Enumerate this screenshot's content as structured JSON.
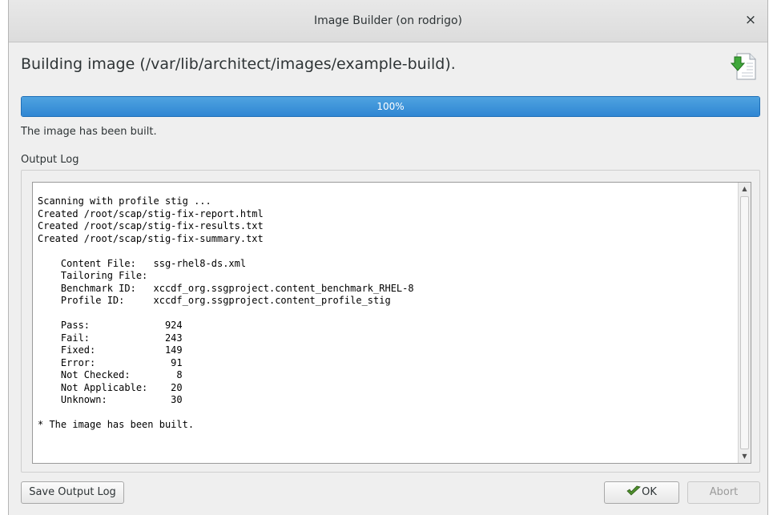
{
  "window": {
    "title": "Image Builder (on rodrigo)",
    "close_label": "×"
  },
  "header": {
    "heading": "Building image (/var/lib/architect/images/example-build).",
    "icon": "document-download-icon"
  },
  "progress": {
    "percent": 100,
    "label": "100%"
  },
  "status": "The image has been built.",
  "output_log": {
    "label": "Output Log",
    "lines": [
      "Scanning with profile stig ...",
      "Created /root/scap/stig-fix-report.html",
      "Created /root/scap/stig-fix-results.txt",
      "Created /root/scap/stig-fix-summary.txt",
      "",
      "    Content File:   ssg-rhel8-ds.xml",
      "    Tailoring File:",
      "    Benchmark ID:   xccdf_org.ssgproject.content_benchmark_RHEL-8",
      "    Profile ID:     xccdf_org.ssgproject.content_profile_stig",
      "",
      "    Pass:             924",
      "    Fail:             243",
      "    Fixed:            149",
      "    Error:             91",
      "    Not Checked:        8",
      "    Not Applicable:    20",
      "    Unknown:           30",
      "",
      "* The image has been built."
    ]
  },
  "buttons": {
    "save_log": "Save Output Log",
    "ok": "OK",
    "abort": "Abort"
  },
  "colors": {
    "progress_fill": "#3592dc",
    "window_bg": "#efefef"
  }
}
